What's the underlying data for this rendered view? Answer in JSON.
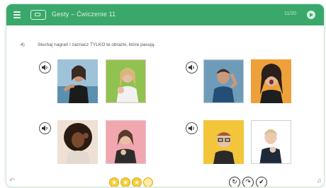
{
  "header": {
    "breadcrumb": "Gesty – Ćwiczenie 11",
    "right_text": "11/20",
    "accent": "#3aa86b"
  },
  "task": {
    "number": "4)",
    "instruction": "Słuchaj nagrań i zaznacz TYLKO te obrazki, które pasują."
  },
  "groups": [
    {
      "audio_icon": "speaker-icon",
      "photos": [
        {
          "description_icon": "photo-woman-sea"
        },
        {
          "description_icon": "photo-girl-thumbs-up"
        }
      ]
    },
    {
      "audio_icon": "speaker-icon",
      "photos": [
        {
          "description_icon": "photo-man-listening"
        },
        {
          "description_icon": "photo-woman-surprised"
        }
      ]
    },
    {
      "audio_icon": "speaker-icon",
      "photos": [
        {
          "description_icon": "photo-woman-curly-hair"
        },
        {
          "description_icon": "photo-woman-pointing"
        }
      ]
    },
    {
      "audio_icon": "speaker-icon",
      "photos": [
        {
          "description_icon": "photo-boy-glasses"
        },
        {
          "description_icon": "photo-child-gesture"
        }
      ]
    }
  ],
  "footer": {
    "stars_count": 4,
    "star_color": "#f7cf34",
    "controls": [
      "reset-icon",
      "skip-icon",
      "check-icon"
    ],
    "left_corner": "↶",
    "right_corner": "♫"
  }
}
